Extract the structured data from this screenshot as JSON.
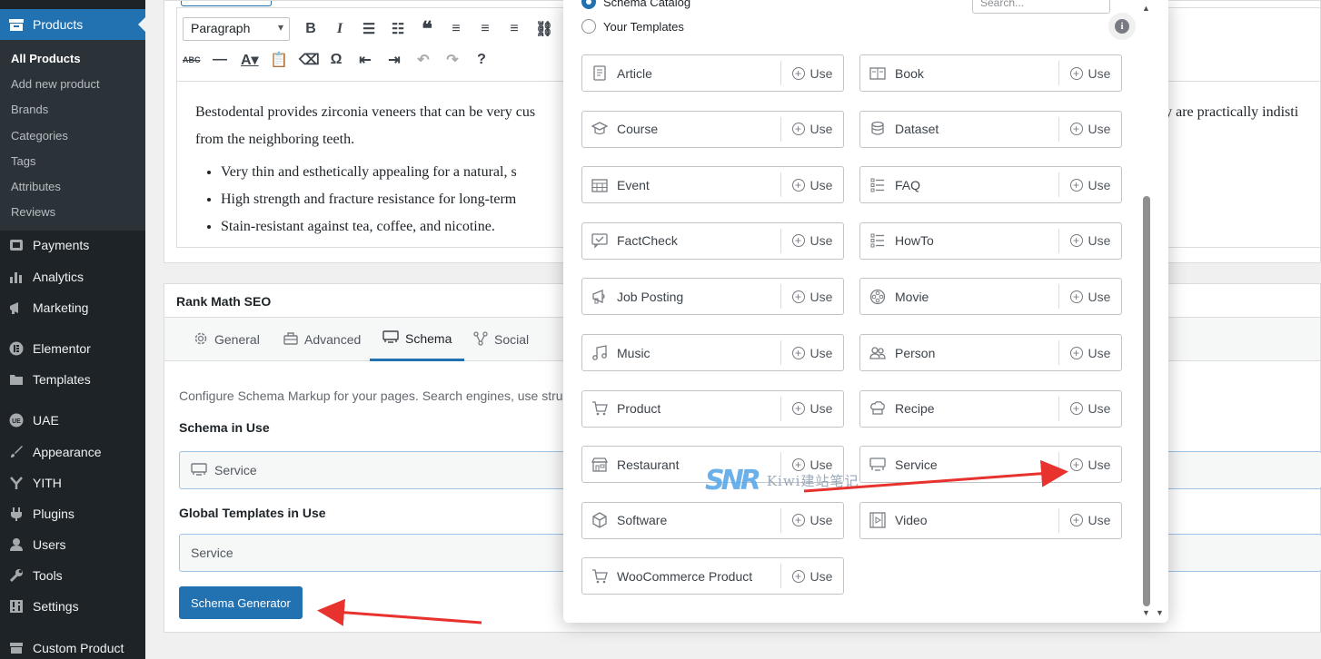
{
  "sidebar": {
    "products": "Products",
    "submenu": [
      "All Products",
      "Add new product",
      "Brands",
      "Categories",
      "Tags",
      "Attributes",
      "Reviews"
    ],
    "items": [
      "Payments",
      "Analytics",
      "Marketing",
      "Elementor",
      "Templates",
      "UAE",
      "Appearance",
      "YITH",
      "Plugins",
      "Users",
      "Tools",
      "Settings",
      "Custom Product"
    ]
  },
  "editor": {
    "format": "Paragraph",
    "paragraph": "Bestodental provides zirconia veneers that can be very cus",
    "paragraph_tail": "ey are practically indisti",
    "paragraph_line2": "from the neighboring teeth.",
    "bullets": [
      "Very thin and esthetically appealing for a natural, s",
      "High strength and fracture resistance for long-term",
      "Stain-resistant against tea, coffee, and nicotine."
    ]
  },
  "rankmath": {
    "title": "Rank Math SEO",
    "tabs": [
      "General",
      "Advanced",
      "Schema",
      "Social"
    ],
    "description": "Configure Schema Markup for your pages. Search engines, use stru",
    "schema_in_use_label": "Schema in Use",
    "schema_in_use_value": "Service",
    "global_templates_label": "Global Templates in Use",
    "global_templates_value": "Service",
    "generator_button": "Schema Generator"
  },
  "modal": {
    "radio_catalog": "Schema Catalog",
    "radio_templates": "Your Templates",
    "search_placeholder": "Search...",
    "use_label": "Use",
    "schemas": [
      {
        "name": "Article",
        "icon": "article-icon"
      },
      {
        "name": "Book",
        "icon": "book-icon"
      },
      {
        "name": "Course",
        "icon": "course-icon"
      },
      {
        "name": "Dataset",
        "icon": "dataset-icon"
      },
      {
        "name": "Event",
        "icon": "event-icon"
      },
      {
        "name": "FAQ",
        "icon": "faq-icon"
      },
      {
        "name": "FactCheck",
        "icon": "factcheck-icon"
      },
      {
        "name": "HowTo",
        "icon": "howto-icon"
      },
      {
        "name": "Job Posting",
        "icon": "job-posting-icon"
      },
      {
        "name": "Movie",
        "icon": "movie-icon"
      },
      {
        "name": "Music",
        "icon": "music-icon"
      },
      {
        "name": "Person",
        "icon": "person-icon"
      },
      {
        "name": "Product",
        "icon": "product-icon"
      },
      {
        "name": "Recipe",
        "icon": "recipe-icon"
      },
      {
        "name": "Restaurant",
        "icon": "restaurant-icon"
      },
      {
        "name": "Service",
        "icon": "service-icon"
      },
      {
        "name": "Software",
        "icon": "software-icon"
      },
      {
        "name": "Video",
        "icon": "video-icon"
      },
      {
        "name": "WooCommerce Product",
        "icon": "woocommerce-product-icon"
      }
    ]
  },
  "watermark": {
    "text": "Kiwi建站笔记"
  },
  "colors": {
    "accent": "#2271b1",
    "sidebar": "#1d2327",
    "arrow": "#e8322e"
  }
}
